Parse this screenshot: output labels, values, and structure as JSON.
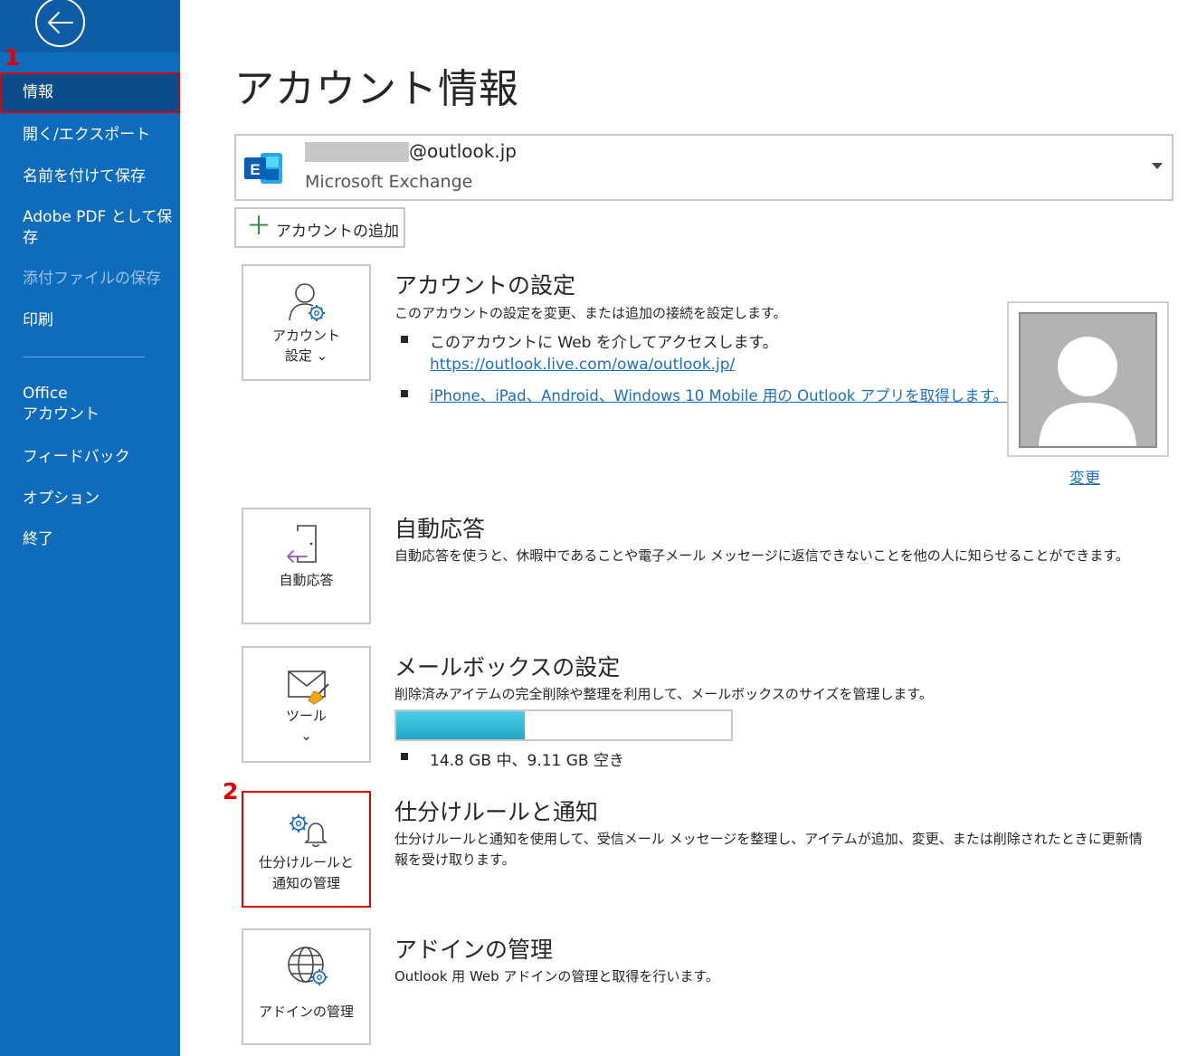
{
  "sidebar": {
    "items": [
      {
        "label": "情報"
      },
      {
        "label": "開く/エクスポート"
      },
      {
        "label": "名前を付けて保存"
      },
      {
        "label": "Adobe PDF として保"
      },
      {
        "label": "存"
      },
      {
        "label": "添付ファイルの保存"
      },
      {
        "label": "印刷"
      },
      {
        "label": "Office"
      },
      {
        "label": "アカウント"
      },
      {
        "label": "フィードバック"
      },
      {
        "label": "オプション"
      },
      {
        "label": "終了"
      }
    ]
  },
  "annotations": {
    "one": "1",
    "two": "2"
  },
  "page": {
    "title": "アカウント情報"
  },
  "account": {
    "email": "@outlook.jp",
    "type": "Microsoft Exchange",
    "add_label": "アカウントの追加"
  },
  "sections": {
    "account_settings": {
      "tile_line1": "アカウント",
      "tile_line2": "設定 ⌄",
      "title": "アカウントの設定",
      "desc": "このアカウントの設定を変更、または追加の接続を設定します。",
      "bullet1": "このアカウントに Web を介してアクセスします。",
      "link1": "https://outlook.live.com/owa/outlook.jp/",
      "link2": "iPhone、iPad、Android、Windows 10 Mobile 用の Outlook アプリを取得します。"
    },
    "profile": {
      "change_label": "変更"
    },
    "auto_reply": {
      "tile_label": "自動応答",
      "title": "自動応答",
      "desc": "自動応答を使うと、休暇中であることや電子メール メッセージに返信できないことを他の人に知らせることができます。"
    },
    "mailbox": {
      "tile_label": "ツール",
      "tile_caret": "⌄",
      "title": "メールボックスの設定",
      "desc": "削除済みアイテムの完全削除や整理を利用して、メールボックスのサイズを管理します。",
      "usage_fraction": 0.385,
      "usage_text": "14.8 GB 中、9.11 GB 空き"
    },
    "rules": {
      "tile_line1": "仕分けルールと",
      "tile_line2": "通知の管理",
      "title": "仕分けルールと通知",
      "desc_line1": "仕分けルールと通知を使用して、受信メール メッセージを整理し、アイテムが追加、変更、または削除されたときに更新情",
      "desc_line2": "報を受け取ります。"
    },
    "addins": {
      "tile_label": "アドインの管理",
      "title": "アドインの管理",
      "desc": "Outlook 用 Web アドインの管理と取得を行います。"
    }
  },
  "colors": {
    "sidebar": "#0f6cbd",
    "sidebar_selected": "#0c4c8a",
    "highlight": "#e00000",
    "link": "#1b6ec2",
    "accent_icon": "#1b6ec2"
  }
}
